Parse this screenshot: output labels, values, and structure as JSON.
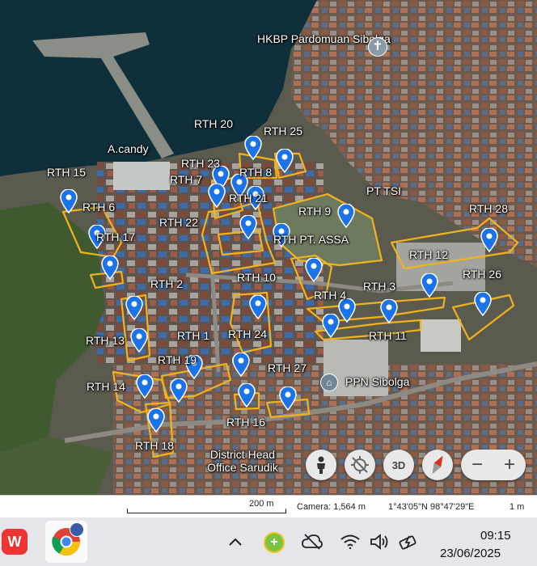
{
  "map": {
    "labels": {
      "church": "HKBP Pardomuan Sibolga",
      "candy": "A.candy",
      "pt_tsi": "PT TSI",
      "ppn": "PPN Sibolga",
      "district_head": "District Head Office Sarudik",
      "rth_20": "RTH 20",
      "rth_25": "RTH 25",
      "rth_15": "RTH 15",
      "rth_23": "RTH 23",
      "rth_7": "RTH 7",
      "rth_8": "RTH 8",
      "rth_21": "RTH 21",
      "rth_6": "RTH 6",
      "rth_22": "RTH 22",
      "rth_9": "RTH 9",
      "rth_28": "RTH 28",
      "rth_17": "RTH 17",
      "rth_pt_assa": "RTH PT. ASSA",
      "rth_12": "RTH 12",
      "rth_26": "RTH 26",
      "rth_2": "RTH 2",
      "rth_10": "RTH 10",
      "rth_3": "RTH 3",
      "rth_4": "RTH 4",
      "rth_1": "RTH 1",
      "rth_24": "RTH 24",
      "rth_11": "RTH 11",
      "rth_13": "RTH 13",
      "rth_19": "RTH 19",
      "rth_27": "RTH 27",
      "rth_14": "RTH 14",
      "rth_16": "RTH 16",
      "rth_18": "RTH 18"
    },
    "controls": {
      "three_d": "3D",
      "zoom_out": "−",
      "zoom_in": "+"
    },
    "colors": {
      "outline": "#f2b21b",
      "pin": "#1a73e8",
      "water": "#0f2f3a",
      "land": "#4b5a42"
    }
  },
  "status": {
    "scale": "200 m",
    "camera": "Camera: 1,564 m",
    "coords": "1°43'05\"N 98°47'29\"E",
    "accuracy": "1 m"
  },
  "taskbar": {
    "time": "09:15",
    "date": "23/06/2025",
    "icons": [
      "wps-office-icon",
      "chrome-icon",
      "chevron-up-icon",
      "green-plus-app-icon",
      "cloud-offline-icon",
      "wifi-icon",
      "speaker-icon",
      "battery-charging-icon"
    ]
  }
}
